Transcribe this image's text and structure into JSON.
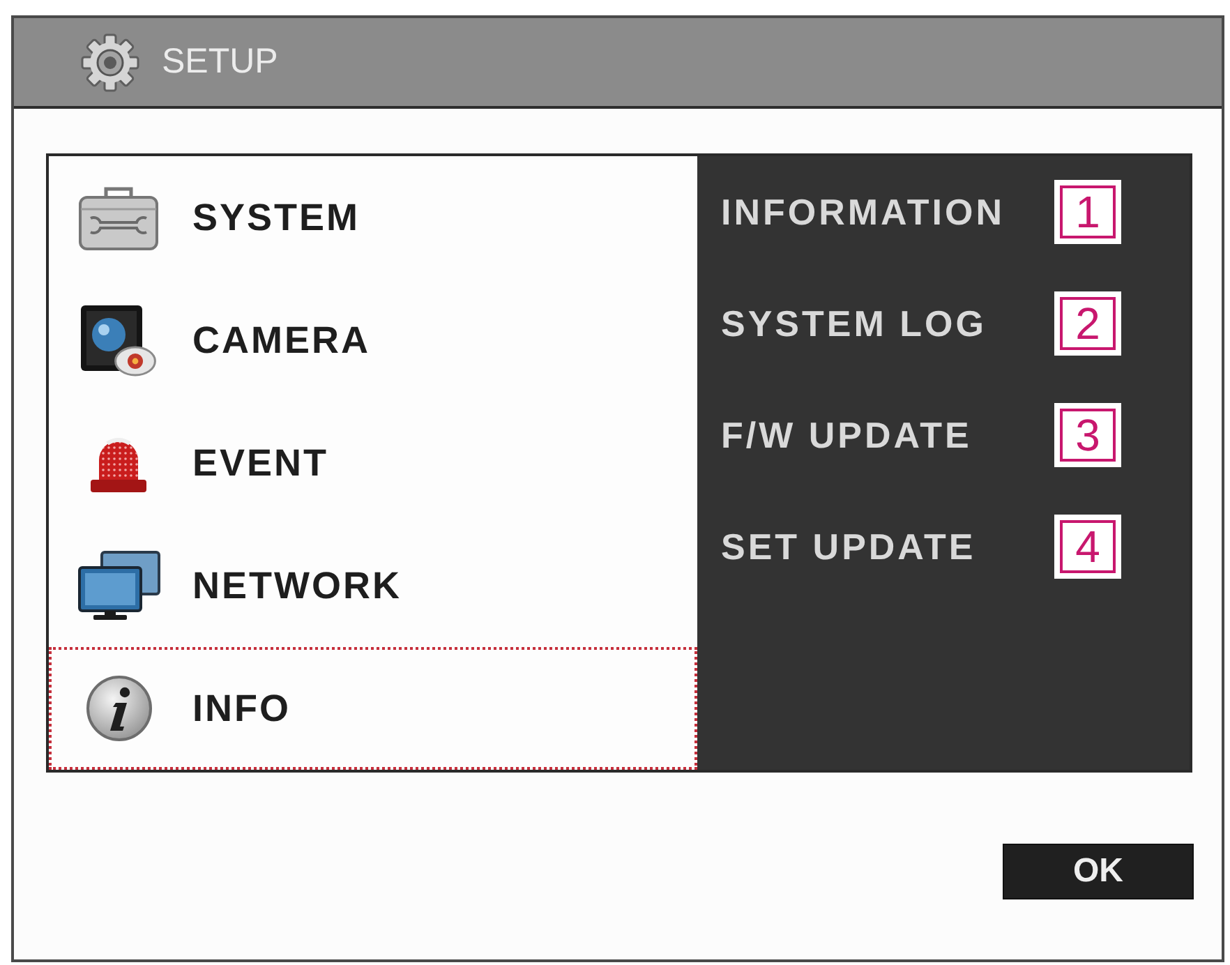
{
  "window": {
    "title": "SETUP"
  },
  "menu": [
    {
      "label": "SYSTEM",
      "selected": false
    },
    {
      "label": "CAMERA",
      "selected": false
    },
    {
      "label": "EVENT",
      "selected": false
    },
    {
      "label": "NETWORK",
      "selected": false
    },
    {
      "label": "INFO",
      "selected": true
    }
  ],
  "submenu": [
    {
      "label": "INFORMATION",
      "callout": "1"
    },
    {
      "label": "SYSTEM LOG",
      "callout": "2"
    },
    {
      "label": "F/W UPDATE",
      "callout": "3"
    },
    {
      "label": "SET UPDATE",
      "callout": "4"
    }
  ],
  "buttons": [
    "OK"
  ]
}
